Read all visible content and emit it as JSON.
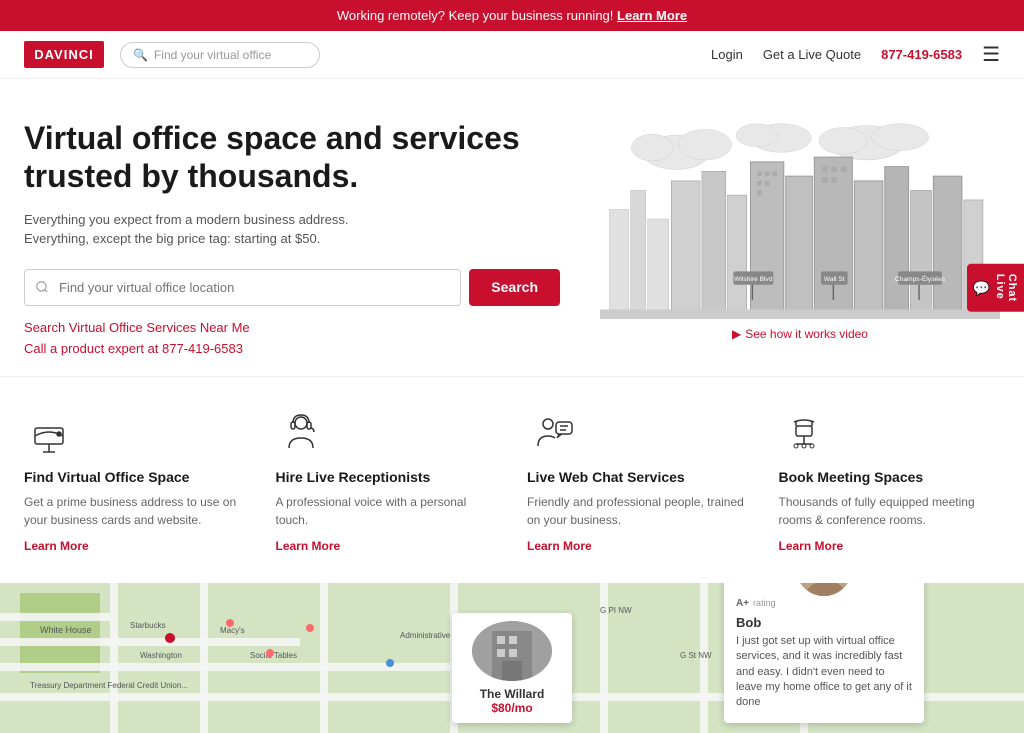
{
  "banner": {
    "text": "Working remotely? Keep your business running!",
    "link": "Learn More"
  },
  "header": {
    "logo": "DAVINCI",
    "search_placeholder": "Find your virtual office",
    "nav": {
      "login": "Login",
      "quote": "Get a Live Quote",
      "phone": "877-419-6583"
    }
  },
  "hero": {
    "title": "Virtual office space and services trusted by thousands.",
    "subtitle_line1": "Everything you expect from a modern business address.",
    "subtitle_line2": "Everything, except the big price tag: starting at $50.",
    "search_placeholder": "Find your virtual office location",
    "search_button": "Search",
    "links": [
      "Search Virtual Office Services Near Me",
      "Call a product expert at 877-419-6583"
    ],
    "video_link": "See how it works video",
    "city_labels": [
      "Wilshire Blvd",
      "Wall St",
      "Champs-Élysées"
    ]
  },
  "services": [
    {
      "id": "virtual-office",
      "title": "Find Virtual Office Space",
      "description": "Get a prime business address to use on your business cards and website.",
      "link": "Learn More",
      "icon": "mailbox-icon"
    },
    {
      "id": "receptionists",
      "title": "Hire Live Receptionists",
      "description": "A professional voice with a personal touch.",
      "link": "Learn More",
      "icon": "headset-icon"
    },
    {
      "id": "webchat",
      "title": "Live Web Chat Services",
      "description": "Friendly and professional people, trained on your business.",
      "link": "Learn More",
      "icon": "chat-icon"
    },
    {
      "id": "meeting",
      "title": "Book Meeting Spaces",
      "description": "Thousands of fully equipped meeting rooms & conference rooms.",
      "link": "Learn More",
      "icon": "chair-icon"
    }
  ],
  "map": {
    "location_card": {
      "name": "The Willard",
      "price": "$80/mo"
    }
  },
  "testimonial": {
    "name": "Bob",
    "rating": "A+",
    "text": "I just got set up with virtual office services, and it was incredibly fast and easy. I didn't even need to leave my home office to get any of it done"
  },
  "live_chat": {
    "label": "Live Chat",
    "icon": "chat-bubble-icon"
  }
}
